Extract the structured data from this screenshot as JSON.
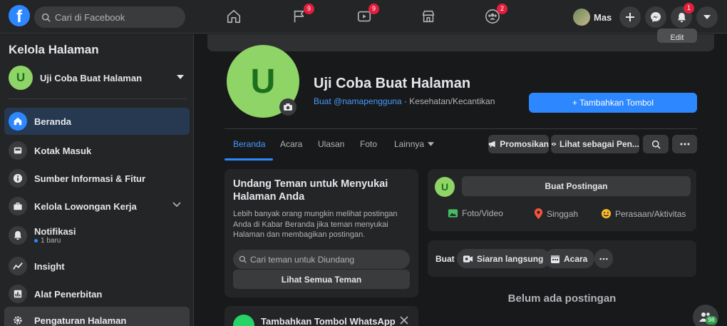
{
  "topbar": {
    "logo": "f",
    "search_placeholder": "Cari di Facebook",
    "nav": [
      {
        "icon": "home-icon",
        "badge": ""
      },
      {
        "icon": "flag-icon",
        "badge": "9"
      },
      {
        "icon": "watch-icon",
        "badge": "9"
      },
      {
        "icon": "marketplace-icon",
        "badge": ""
      },
      {
        "icon": "groups-icon",
        "badge": "2"
      }
    ],
    "profile_name": "Mas",
    "notifications_badge": "1"
  },
  "sidebar": {
    "title": "Kelola Halaman",
    "page_avatar_letter": "U",
    "page_name": "Uji Coba Buat Halaman",
    "items": [
      {
        "label": "Beranda",
        "icon": "home-icon",
        "active": true
      },
      {
        "label": "Kotak Masuk",
        "icon": "inbox-icon"
      },
      {
        "label": "Sumber Informasi & Fitur",
        "icon": "info-icon"
      },
      {
        "label": "Kelola Lowongan Kerja",
        "icon": "briefcase-icon"
      },
      {
        "label": "Notifikasi",
        "icon": "bell-icon",
        "sub": "1 baru"
      },
      {
        "label": "Insight",
        "icon": "insight-icon"
      },
      {
        "label": "Alat Penerbitan",
        "icon": "publishing-icon"
      },
      {
        "label": "Pengaturan Halaman",
        "icon": "gear-icon"
      }
    ]
  },
  "header": {
    "edit_label": "Edit",
    "avatar_letter": "U",
    "page_title": "Uji Coba Buat Halaman",
    "username_link": "Buat @namapengguna",
    "separator": " · ",
    "category": "Kesehatan/Kecantikan",
    "add_button": "+ Tambahkan Tombol"
  },
  "tabs": [
    "Beranda",
    "Acara",
    "Ulasan",
    "Foto",
    "Lainnya"
  ],
  "tab_actions": {
    "promote": "Promosikan",
    "view_as": "Lihat sebagai Pen..."
  },
  "invite_card": {
    "title": "Undang Teman untuk Menyukai Halaman Anda",
    "body": "Lebih banyak orang mungkin melihat postingan Anda di Kabar Beranda jika teman menyukai Halaman dan membagikan postingan.",
    "search_placeholder": "Cari teman untuk Diundang",
    "see_all": "Lihat Semua Teman"
  },
  "whatsapp_card": {
    "title": "Tambahkan Tombol WhatsApp"
  },
  "composer": {
    "avatar_letter": "U",
    "create_post": "Buat Postingan",
    "actions": [
      "Foto/Video",
      "Singgah",
      "Perasaan/Aktivitas"
    ]
  },
  "create_bar": {
    "label": "Buat",
    "live": "Siaran langsung",
    "event": "Acara"
  },
  "empty_state": "Belum ada postingan",
  "contacts_badge": "98",
  "colors": {
    "accent": "#2d88ff",
    "badge": "#e41e3f",
    "avatar_bg": "#8fd466",
    "avatar_fg": "#1c6f1c"
  }
}
